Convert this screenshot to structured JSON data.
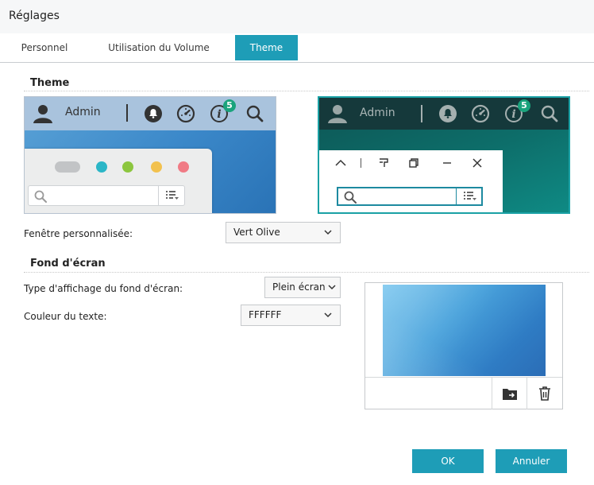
{
  "window": {
    "title": "Réglages"
  },
  "tabs": [
    {
      "label": "Personnel"
    },
    {
      "label": "Utilisation du Volume"
    },
    {
      "label": "Theme",
      "active": true
    }
  ],
  "theme": {
    "section_title": "Theme",
    "preview_light": {
      "user_label": "Admin",
      "notification_count": "5"
    },
    "preview_dark": {
      "user_label": "Admin",
      "notification_count": "5"
    },
    "window_label": "Fenêtre personnalisée:",
    "window_value": "Vert Olive"
  },
  "wallpaper": {
    "section_title": "Fond d'écran",
    "display_type_label": "Type d'affichage du fond d'écran:",
    "display_type_value": "Plein écran",
    "text_color_label": "Couleur du texte:",
    "text_color_value": "FFFFFF"
  },
  "footer": {
    "ok_label": "OK",
    "cancel_label": "Annuler"
  },
  "colors": {
    "accent": "#1e9db7",
    "badge": "#1aa37c",
    "dot_teal": "#2bb6c7",
    "dot_green": "#8cc63f",
    "dot_yellow": "#f2c14e",
    "dot_red": "#f07b85"
  }
}
